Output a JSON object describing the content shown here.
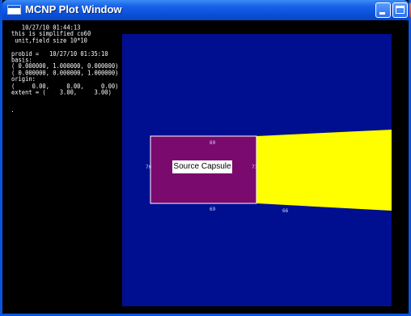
{
  "window": {
    "title": "MCNP Plot Window"
  },
  "info_panel": {
    "lines": [
      "   10/27/10 01:44:13",
      "this is simplified co60",
      " unit,field size 10*10",
      "",
      "probid =   10/27/10 01:35:10",
      "basis:",
      "( 0.000000, 1.000000, 0.000000)",
      "( 0.000000, 0.000000, 1.000000)",
      "origin:",
      "(     0.00,     0.00,     0.00)",
      "extent = (    3.00,     3.00)"
    ]
  },
  "plot": {
    "background_color": "#000f90",
    "cell_labels": [
      "69",
      "70",
      "71",
      "69",
      "66"
    ],
    "source_capsule": {
      "label": "Source Capsule",
      "fill_color": "#7a0a6e",
      "border_color": "#ffffff"
    },
    "beam": {
      "fill_color": "#ffff00"
    }
  }
}
